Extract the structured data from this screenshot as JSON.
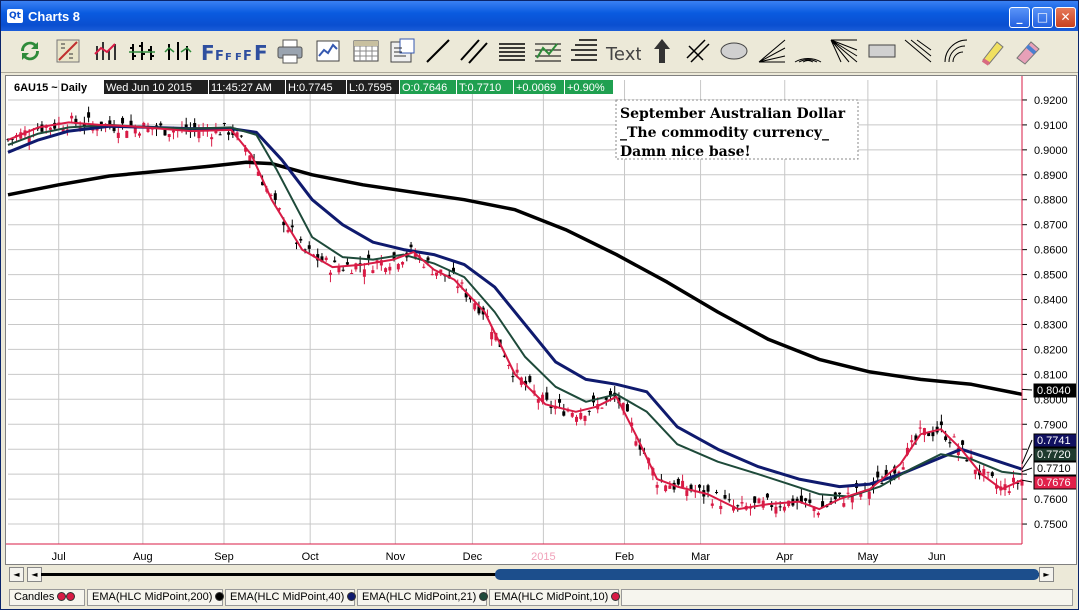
{
  "window": {
    "title": "Charts 8",
    "app_icon": "Qt"
  },
  "toolbar": {
    "icons": [
      "refresh-icon",
      "draw-icon",
      "bar-chart-icon",
      "hlc-bars-icon",
      "candles-icon",
      "font-icon",
      "print-icon",
      "chart-icon",
      "grid-icon",
      "properties-icon",
      "line-icon",
      "parallel-lines-icon",
      "horizontal-lines-icon",
      "fibonacci-icon",
      "levels-icon",
      "text-icon",
      "arrow-up-icon",
      "crosshair-icon",
      "ellipse-icon",
      "fan-icon",
      "arc-icon",
      "gann-fan-icon",
      "rectangle-icon",
      "speed-lines-icon",
      "spiral-icon",
      "highlighter-icon",
      "eraser-icon"
    ],
    "text_label": "Text"
  },
  "header": {
    "symbol": "6AU15 ~ Daily",
    "datetime_date": "Wed Jun 10 2015",
    "datetime_time": "11:45:27 AM",
    "high": "H:0.7745",
    "low": "L:0.7595",
    "open": "O:0.7646",
    "last": "T:0.7710",
    "change": "+0.0069",
    "change_pct": "+0.90%"
  },
  "annotation": {
    "line1": "September Australian Dollar",
    "line2": "_The commodity currency_",
    "line3": "Damn nice base!"
  },
  "price_labels": [
    {
      "text": "0.8040",
      "value": 0.804,
      "bg": "#000000",
      "fg": "#FFFFFF"
    },
    {
      "text": "0.7741",
      "value": 0.7741,
      "bg": "#101060",
      "fg": "#FFFFFF"
    },
    {
      "text": "0.7720",
      "value": 0.772,
      "bg": "#1E3A2E",
      "fg": "#FFFFFF"
    },
    {
      "text": "0.7710",
      "value": 0.771,
      "bg": "#FFFFFF",
      "fg": "#000000"
    },
    {
      "text": "0.7676",
      "value": 0.7676,
      "bg": "#E0204A",
      "fg": "#FFFFFF"
    }
  ],
  "scroll": {
    "left": "◄",
    "right": "►",
    "home": "◄"
  },
  "legend": {
    "candles": "Candles",
    "ema200": "EMA(HLC MidPoint,200)",
    "ema40": "EMA(HLC MidPoint,40)",
    "ema21": "EMA(HLC MidPoint,21)",
    "ema10": "EMA(HLC MidPoint,10)"
  },
  "colors": {
    "ema200": "#000000",
    "ema40": "#0F1A6E",
    "ema21": "#1E4A3A",
    "ema10": "#D81B45",
    "up": "#D81B45",
    "down": "#000000",
    "grid": "#C8C8C8"
  },
  "chart_data": {
    "type": "line",
    "ylim": [
      0.742,
      0.928
    ],
    "yticks": [
      "0.9200",
      "0.9100",
      "0.9000",
      "0.8900",
      "0.8800",
      "0.8700",
      "0.8600",
      "0.8500",
      "0.8400",
      "0.8300",
      "0.8200",
      "0.8100",
      "0.8000",
      "0.7900",
      "0.7800",
      "0.7700",
      "0.7600",
      "0.7500"
    ],
    "xticks": [
      {
        "label": "Jul",
        "t": 0.05
      },
      {
        "label": "Aug",
        "t": 0.133
      },
      {
        "label": "Sep",
        "t": 0.213
      },
      {
        "label": "Oct",
        "t": 0.298
      },
      {
        "label": "Nov",
        "t": 0.382
      },
      {
        "label": "Dec",
        "t": 0.458
      },
      {
        "label": "2015",
        "t": 0.528,
        "faint": true
      },
      {
        "label": "Feb",
        "t": 0.608
      },
      {
        "label": "Mar",
        "t": 0.683
      },
      {
        "label": "Apr",
        "t": 0.766
      },
      {
        "label": "May",
        "t": 0.848
      },
      {
        "label": "Jun",
        "t": 0.916
      }
    ],
    "series": [
      {
        "name": "EMA(HLC MidPoint,200)",
        "color": "#000000",
        "width": 3.5,
        "t": [
          0,
          0.05,
          0.1,
          0.15,
          0.2,
          0.235,
          0.26,
          0.3,
          0.35,
          0.4,
          0.45,
          0.5,
          0.55,
          0.6,
          0.65,
          0.7,
          0.75,
          0.8,
          0.85,
          0.9,
          0.95,
          1.0
        ],
        "y": [
          0.882,
          0.886,
          0.8895,
          0.8915,
          0.8935,
          0.895,
          0.8945,
          0.89,
          0.886,
          0.883,
          0.88,
          0.876,
          0.868,
          0.858,
          0.847,
          0.835,
          0.824,
          0.816,
          0.811,
          0.808,
          0.806,
          0.802
        ]
      },
      {
        "name": "EMA(HLC MidPoint,40)",
        "color": "#0F1A6E",
        "width": 3,
        "t": [
          0,
          0.03,
          0.06,
          0.1,
          0.14,
          0.18,
          0.22,
          0.245,
          0.27,
          0.3,
          0.33,
          0.36,
          0.39,
          0.42,
          0.45,
          0.48,
          0.51,
          0.54,
          0.57,
          0.6,
          0.63,
          0.66,
          0.7,
          0.74,
          0.78,
          0.82,
          0.85,
          0.88,
          0.91,
          0.94,
          0.97,
          1.0
        ],
        "y": [
          0.899,
          0.904,
          0.9075,
          0.9095,
          0.909,
          0.9085,
          0.9085,
          0.907,
          0.896,
          0.88,
          0.87,
          0.863,
          0.86,
          0.858,
          0.854,
          0.845,
          0.83,
          0.815,
          0.808,
          0.806,
          0.803,
          0.789,
          0.78,
          0.773,
          0.768,
          0.765,
          0.766,
          0.77,
          0.775,
          0.78,
          0.776,
          0.772
        ]
      },
      {
        "name": "EMA(HLC MidPoint,21)",
        "color": "#1E4A3A",
        "width": 2,
        "t": [
          0,
          0.03,
          0.06,
          0.1,
          0.14,
          0.18,
          0.22,
          0.245,
          0.265,
          0.3,
          0.33,
          0.36,
          0.39,
          0.42,
          0.45,
          0.48,
          0.51,
          0.54,
          0.57,
          0.6,
          0.63,
          0.66,
          0.7,
          0.74,
          0.77,
          0.8,
          0.83,
          0.86,
          0.89,
          0.92,
          0.95,
          0.98,
          1.0
        ],
        "y": [
          0.902,
          0.9065,
          0.909,
          0.91,
          0.909,
          0.9085,
          0.909,
          0.906,
          0.892,
          0.865,
          0.857,
          0.856,
          0.858,
          0.8545,
          0.849,
          0.835,
          0.817,
          0.805,
          0.799,
          0.802,
          0.795,
          0.782,
          0.775,
          0.77,
          0.766,
          0.762,
          0.761,
          0.765,
          0.772,
          0.778,
          0.776,
          0.771,
          0.77
        ]
      },
      {
        "name": "EMA(HLC MidPoint,10)",
        "color": "#D81B45",
        "width": 2,
        "t": [
          0,
          0.03,
          0.06,
          0.09,
          0.12,
          0.15,
          0.18,
          0.22,
          0.24,
          0.26,
          0.29,
          0.32,
          0.35,
          0.38,
          0.4,
          0.42,
          0.44,
          0.47,
          0.5,
          0.53,
          0.56,
          0.58,
          0.6,
          0.62,
          0.64,
          0.66,
          0.69,
          0.72,
          0.75,
          0.78,
          0.8,
          0.82,
          0.85,
          0.88,
          0.9,
          0.92,
          0.94,
          0.96,
          0.98,
          1.0
        ],
        "y": [
          0.904,
          0.909,
          0.911,
          0.91,
          0.9095,
          0.9085,
          0.9075,
          0.908,
          0.898,
          0.88,
          0.86,
          0.853,
          0.854,
          0.856,
          0.859,
          0.852,
          0.848,
          0.835,
          0.81,
          0.798,
          0.795,
          0.797,
          0.801,
          0.785,
          0.768,
          0.765,
          0.762,
          0.756,
          0.758,
          0.759,
          0.756,
          0.76,
          0.764,
          0.774,
          0.786,
          0.788,
          0.78,
          0.77,
          0.764,
          0.7676
        ]
      }
    ]
  }
}
